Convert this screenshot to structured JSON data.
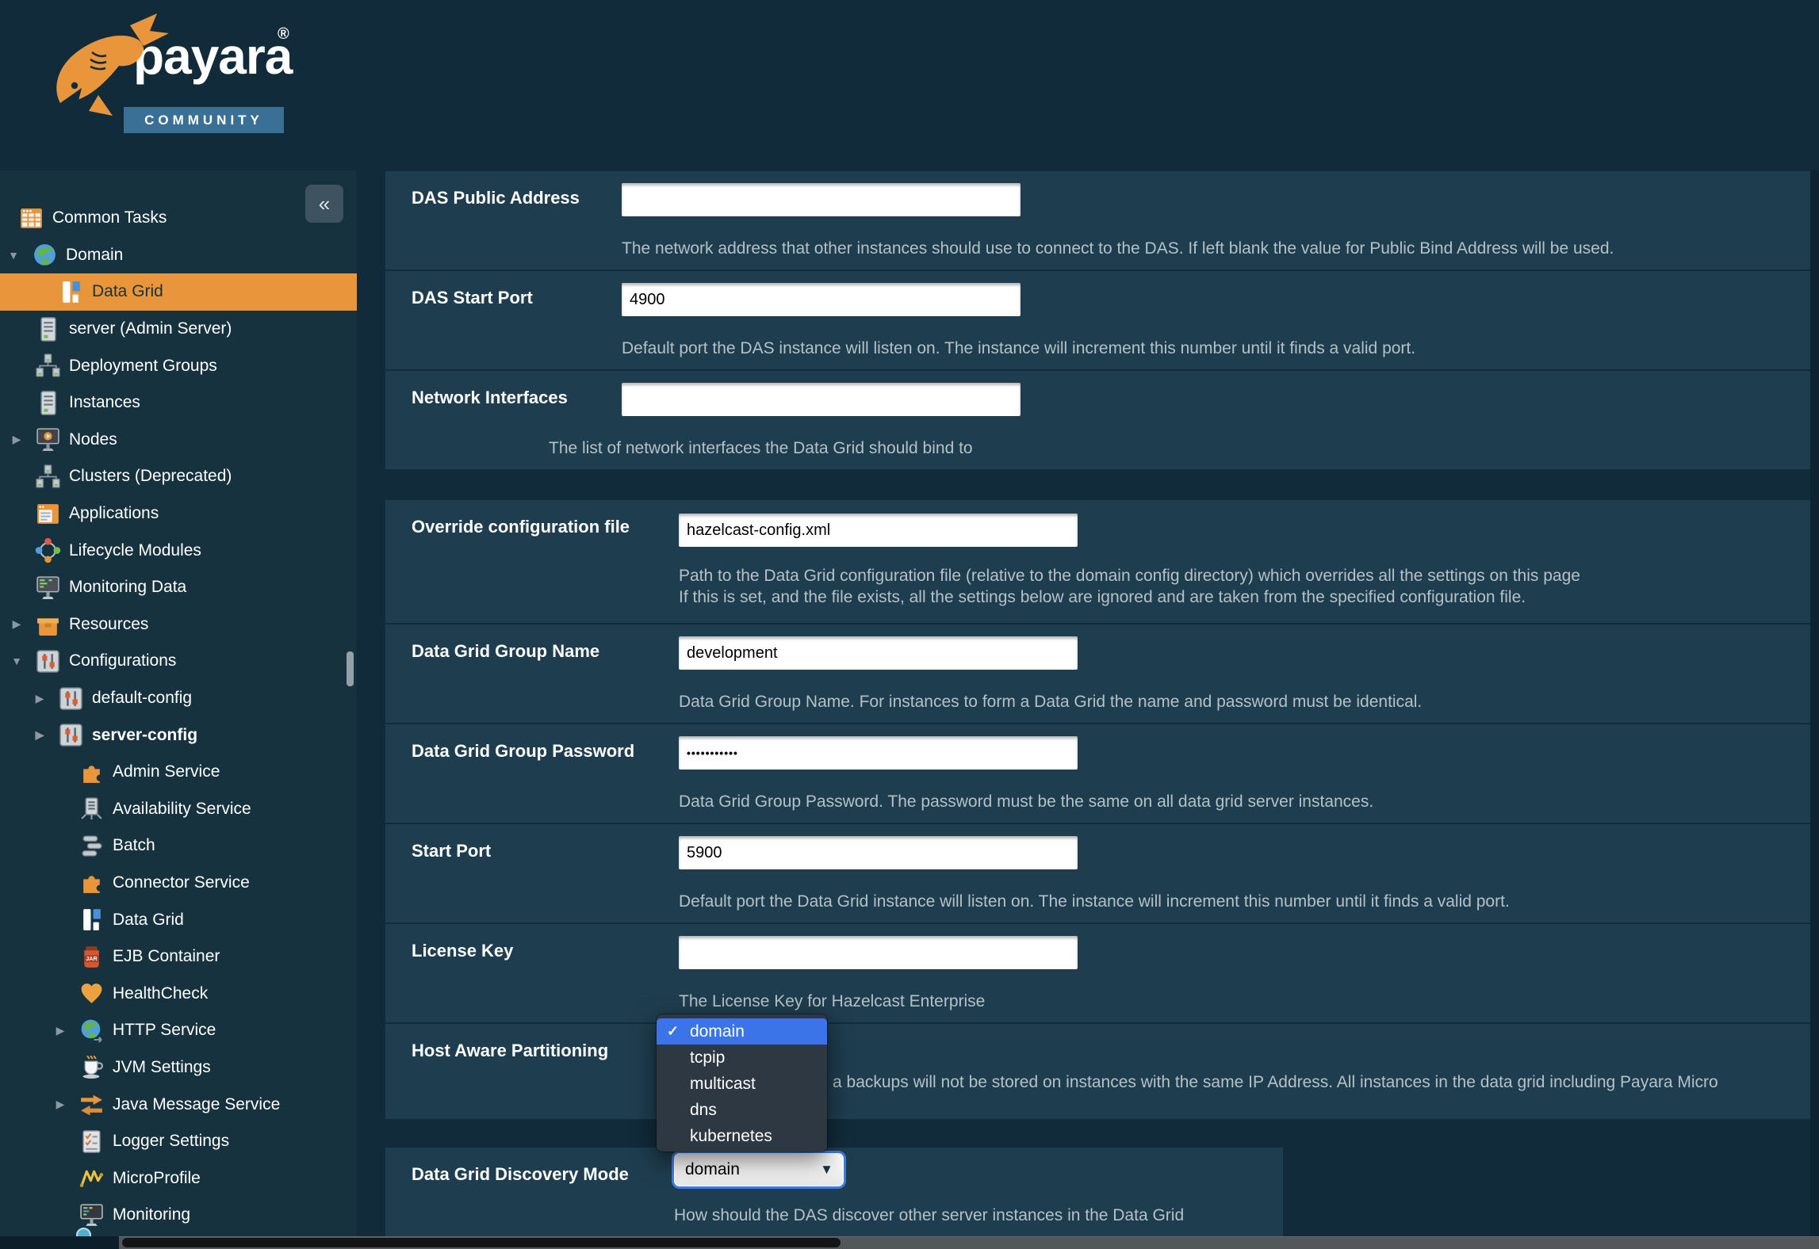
{
  "logo": {
    "brand": "payara",
    "registered": "®",
    "community": "COMMUNITY"
  },
  "colors": {
    "brand_orange": "#e8953c",
    "banner_blue": "#3a7095",
    "selection_blue": "#3b74e8",
    "focus_ring": "#3f7ce6",
    "row_bg": "#1e3d4e",
    "sidebar_bg": "#17323f",
    "page_bg": "#112b3a",
    "desc_text": "#b5c1c8"
  },
  "sidebar": {
    "collapse_glyph": "«",
    "expander_open_glyph": "▼",
    "expander_closed_glyph": "▶",
    "items": [
      {
        "label": "Common Tasks",
        "icon": "tasks-icon",
        "indent": 23,
        "exp": "",
        "sel": false,
        "bold": false
      },
      {
        "label": "Domain",
        "icon": "globe-icon",
        "indent": 40,
        "exp": "open",
        "sel": false,
        "bold": false
      },
      {
        "label": "Data Grid",
        "icon": "data-grid-icon",
        "indent": 73,
        "exp": "",
        "sel": true,
        "bold": false
      },
      {
        "label": "server (Admin Server)",
        "icon": "server-icon",
        "indent": 44,
        "exp": "",
        "sel": false,
        "bold": false
      },
      {
        "label": "Deployment Groups",
        "icon": "cluster-icon",
        "indent": 44,
        "exp": "",
        "sel": false,
        "bold": false
      },
      {
        "label": "Instances",
        "icon": "server-icon",
        "indent": 44,
        "exp": "",
        "sel": false,
        "bold": false
      },
      {
        "label": "Nodes",
        "icon": "node-monitor-icon",
        "indent": 44,
        "exp": "closed",
        "sel": false,
        "bold": false
      },
      {
        "label": "Clusters (Deprecated)",
        "icon": "cluster-icon",
        "indent": 44,
        "exp": "",
        "sel": false,
        "bold": false
      },
      {
        "label": "Applications",
        "icon": "applications-icon",
        "indent": 44,
        "exp": "",
        "sel": false,
        "bold": false
      },
      {
        "label": "Lifecycle Modules",
        "icon": "lifecycle-icon",
        "indent": 44,
        "exp": "",
        "sel": false,
        "bold": false
      },
      {
        "label": "Monitoring Data",
        "icon": "monitor-data-icon",
        "indent": 44,
        "exp": "",
        "sel": false,
        "bold": false
      },
      {
        "label": "Resources",
        "icon": "resources-box-icon",
        "indent": 44,
        "exp": "closed",
        "sel": false,
        "bold": false
      },
      {
        "label": "Configurations",
        "icon": "sliders-icon",
        "indent": 44,
        "exp": "open",
        "sel": false,
        "bold": false
      },
      {
        "label": "default-config",
        "icon": "sliders-icon",
        "indent": 73,
        "exp": "closed",
        "sel": false,
        "bold": false
      },
      {
        "label": "server-config",
        "icon": "sliders-icon",
        "indent": 73,
        "exp": "closed",
        "sel": false,
        "bold": true
      },
      {
        "label": "Admin Service",
        "icon": "puzzle-icon",
        "indent": 99,
        "exp": "",
        "sel": false,
        "bold": false
      },
      {
        "label": "Availability Service",
        "icon": "availability-icon",
        "indent": 99,
        "exp": "",
        "sel": false,
        "bold": false
      },
      {
        "label": "Batch",
        "icon": "batch-icon",
        "indent": 99,
        "exp": "",
        "sel": false,
        "bold": false
      },
      {
        "label": "Connector Service",
        "icon": "puzzle-icon",
        "indent": 99,
        "exp": "",
        "sel": false,
        "bold": false
      },
      {
        "label": "Data Grid",
        "icon": "data-grid-icon",
        "indent": 99,
        "exp": "",
        "sel": false,
        "bold": false
      },
      {
        "label": "EJB Container",
        "icon": "jar-icon",
        "indent": 99,
        "exp": "",
        "sel": false,
        "bold": false
      },
      {
        "label": "HealthCheck",
        "icon": "heart-icon",
        "indent": 99,
        "exp": "",
        "sel": false,
        "bold": false
      },
      {
        "label": "HTTP Service",
        "icon": "http-globe-icon",
        "indent": 99,
        "exp": "closed",
        "sel": false,
        "bold": false
      },
      {
        "label": "JVM Settings",
        "icon": "coffee-icon",
        "indent": 99,
        "exp": "",
        "sel": false,
        "bold": false
      },
      {
        "label": "Java Message Service",
        "icon": "arrows-icon",
        "indent": 99,
        "exp": "closed",
        "sel": false,
        "bold": false
      },
      {
        "label": "Logger Settings",
        "icon": "clipboard-icon",
        "indent": 99,
        "exp": "",
        "sel": false,
        "bold": false
      },
      {
        "label": "MicroProfile",
        "icon": "microprofile-icon",
        "indent": 99,
        "exp": "",
        "sel": false,
        "bold": false
      },
      {
        "label": "Monitoring",
        "icon": "monitor-dark-icon",
        "indent": 99,
        "exp": "",
        "sel": false,
        "bold": false
      }
    ]
  },
  "main": {
    "rows": [
      {
        "id": "das-public-address",
        "label": "DAS Public Address",
        "type": "text",
        "value": "",
        "descs": [
          "The network address that other instances should use to connect to the DAS. If left blank the value for Public Bind Address will be used."
        ]
      },
      {
        "id": "das-start-port",
        "label": "DAS Start Port",
        "type": "text",
        "value": "4900",
        "descs": [
          "Default port the DAS instance will listen on. The instance will increment this number until it finds a valid port."
        ]
      },
      {
        "id": "network-interfaces",
        "label": "Network Interfaces",
        "type": "text",
        "value": "",
        "descs": [
          "The list of network interfaces the Data Grid should bind to"
        ]
      },
      {
        "id": "override-configuration-file",
        "label": "Override configuration file",
        "type": "text",
        "value": "hazelcast-config.xml",
        "descs": [
          "Path to the Data Grid configuration file (relative to the domain config directory) which overrides all the settings on this page",
          "If this is set, and the file exists, all the settings below are ignored and are taken from the specified configuration file."
        ]
      },
      {
        "id": "data-grid-group-name",
        "label": "Data Grid Group Name",
        "type": "text",
        "value": "development",
        "descs": [
          "Data Grid Group Name. For instances to form a Data Grid the name and password must be identical."
        ]
      },
      {
        "id": "data-grid-group-password",
        "label": "Data Grid Group Password",
        "type": "password",
        "value": "•••••••••••",
        "descs": [
          "Data Grid Group Password. The password must be the same on all data grid server instances."
        ]
      },
      {
        "id": "start-port",
        "label": "Start Port",
        "type": "text",
        "value": "5900",
        "descs": [
          "Default port the Data Grid instance will listen on. The instance will increment this number until it finds a valid port."
        ]
      },
      {
        "id": "license-key",
        "label": "License Key",
        "type": "text",
        "value": "",
        "descs": [
          "The License Key for Hazelcast Enterprise"
        ]
      },
      {
        "id": "host-aware-partitioning",
        "label": "Host Aware Partitioning",
        "type": "none",
        "descs": [],
        "desc_fragment": "a backups will not be stored on instances with the same IP Address. All instances in the data grid including Payara Micro"
      },
      {
        "id": "data-grid-discovery-mode",
        "label": "Data Grid Discovery Mode",
        "type": "select",
        "descs": [
          "How should the DAS discover other server instances in the Data Grid"
        ]
      }
    ],
    "dropdown": {
      "check_glyph": "✓",
      "selected": "domain",
      "options": [
        "domain",
        "tcpip",
        "multicast",
        "dns",
        "kubernetes"
      ]
    }
  }
}
